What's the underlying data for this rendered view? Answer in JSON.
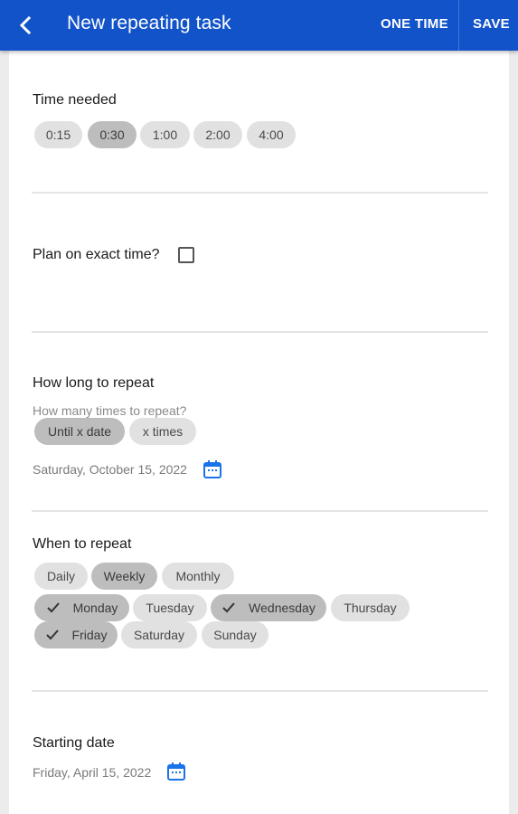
{
  "header": {
    "title": "New repeating task",
    "one_time_label": "ONE TIME",
    "save_label": "SAVE",
    "back_icon": "arrow-back-icon",
    "color": "#1253c9"
  },
  "time_needed": {
    "title": "Time needed",
    "options": [
      "0:15",
      "0:30",
      "1:00",
      "2:00",
      "4:00"
    ],
    "selected": "0:30"
  },
  "exact_time": {
    "label": "Plan on exact time?",
    "checked": false
  },
  "how_long": {
    "title": "How long to repeat",
    "hint": "How many times to repeat?",
    "options": [
      "Until x date",
      "x times"
    ],
    "selected": "Until x date",
    "date": "Saturday, October 15, 2022",
    "date_icon": "calendar-icon"
  },
  "when_to_repeat": {
    "title": "When to repeat",
    "frequency": [
      "Daily",
      "Weekly",
      "Monthly"
    ],
    "selected_frequency": "Weekly",
    "days": [
      "Monday",
      "Tuesday",
      "Wednesday",
      "Thursday",
      "Friday",
      "Saturday",
      "Sunday"
    ],
    "selected_days": [
      "Monday",
      "Wednesday",
      "Friday"
    ]
  },
  "starting_date": {
    "title": "Starting date",
    "date": "Friday, April 15, 2022",
    "date_icon": "calendar-icon"
  },
  "colors": {
    "accent": "#1253c9",
    "chip": "#e1e1e1",
    "chip_selected": "#bdbdbd",
    "calendar_icon": "#1a73e8"
  }
}
